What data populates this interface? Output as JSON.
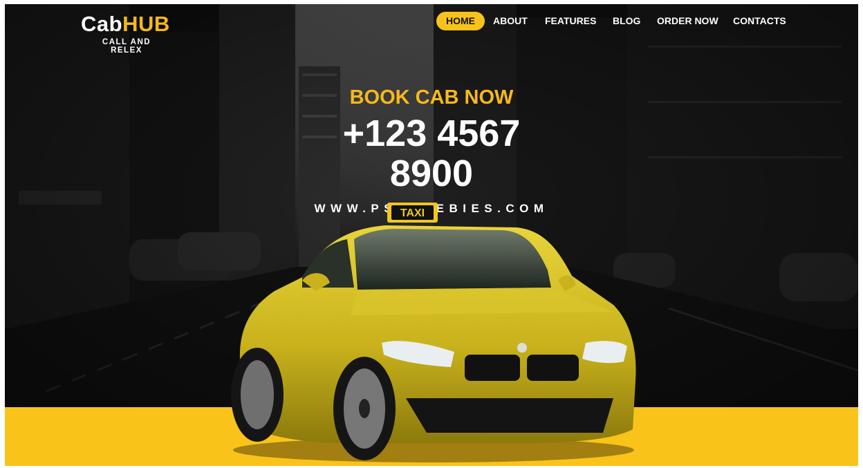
{
  "brand": {
    "name_part1": "Cab",
    "name_part2": "HUB",
    "tagline": "CALL AND RELEX"
  },
  "nav": {
    "items": [
      {
        "label": "HOME",
        "active": true
      },
      {
        "label": "ABOUT",
        "active": false
      },
      {
        "label": "FEATURES",
        "active": false
      },
      {
        "label": "BLOG",
        "active": false
      },
      {
        "label": "ORDER NOW",
        "active": false
      },
      {
        "label": "CONTACTS",
        "active": false
      }
    ]
  },
  "hero": {
    "kicker": "BOOK CAB NOW",
    "phone_line1": "+123 4567",
    "phone_line2": "8900",
    "url": "WWW.PSFREEBIES.COM"
  },
  "car": {
    "sign_text": "TAXI"
  },
  "colors": {
    "accent": "#f7c21b",
    "background": "#0e0e0e",
    "text": "#ffffff"
  }
}
